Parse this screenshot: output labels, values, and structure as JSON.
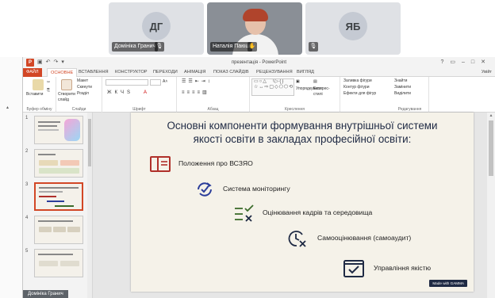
{
  "participants": [
    {
      "initials": "ДГ",
      "name": "Домініка Гранич",
      "mic": "muted-mic-icon"
    },
    {
      "initials": "",
      "name": "Наталія Паюш",
      "mic": "hand-icon"
    },
    {
      "initials": "ЯБ",
      "name": "",
      "mic": "muted-mic-icon"
    }
  ],
  "app": {
    "logo": "P",
    "title": "презентація - PowerPoint",
    "sign_in": "Увійт"
  },
  "tabs": [
    "ФАЙЛ",
    "ОСНОВНЕ",
    "ВСТАВЛЕННЯ",
    "КОНСТРУКТОР",
    "ПЕРЕХОДИ",
    "АНІМАЦІЯ",
    "ПОКАЗ СЛАЙДІВ",
    "РЕЦЕНЗУВАННЯ",
    "ВИГЛЯД"
  ],
  "active_tab": "ОСНОВНЕ",
  "ribbon": {
    "paste": "Вставити",
    "new_slide": "Створити слайд",
    "layout": "Макет",
    "reset": "Скинути",
    "section": "Розділ",
    "clipboard_group": "Буфер обміну",
    "slides_group": "Слайди",
    "font_group": "Шрифт",
    "paragraph_group": "Абзац",
    "arrange": "Упорядкувати",
    "quick_styles": "Експрес-стилі",
    "drawing_group": "Креслення",
    "shape_fill": "Заливка фігури",
    "shape_outline": "Контур фігури",
    "shape_effects": "Ефекти для фігур",
    "find": "Знайти",
    "replace": "Замінити",
    "select": "Виділити",
    "editing_group": "Редагування"
  },
  "thumbnails": [
    {
      "num": "1",
      "caption": "Атмосфера праці"
    },
    {
      "num": "2",
      "caption": "Загальні основи"
    },
    {
      "num": "3",
      "caption": "Основні компоненти"
    },
    {
      "num": "4",
      "caption": "Що передбачає..."
    },
    {
      "num": "5",
      "caption": "Зона саморозвитку"
    }
  ],
  "slide": {
    "title_line1": "Основні компоненти формування внутрішньої системи",
    "title_line2": "якості освіти в закладах професійної освіти:",
    "items": [
      {
        "icon": "book-icon",
        "label": "Положення про ВСЗЯО"
      },
      {
        "icon": "refresh-check-icon",
        "label": "Система моніторингу"
      },
      {
        "icon": "check-cross-list-icon",
        "label": "Оцінювання кадрів та середовища"
      },
      {
        "icon": "clock-cross-icon",
        "label": "Самооцінювання (самоаудит)"
      },
      {
        "icon": "checkbox-window-icon",
        "label": "Управління якістю"
      }
    ],
    "made_with": "Made with GAMMA"
  },
  "presenter_tag": "Домініка Гранич",
  "colors": {
    "ppt_accent": "#d24726",
    "slide_bg": "#f5f2e9",
    "icon_red": "#b0302a",
    "icon_blue": "#2b3d9a",
    "icon_green": "#3b6b2a",
    "icon_navy": "#1f2a44"
  }
}
